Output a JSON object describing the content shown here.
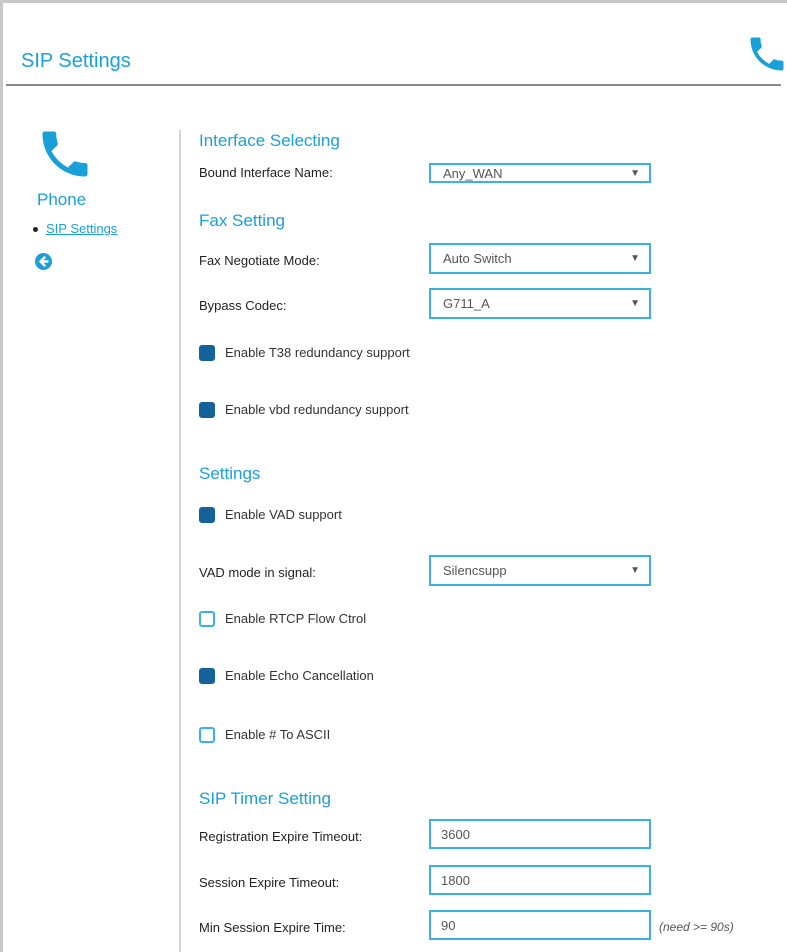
{
  "header": {
    "title": "SIP Settings"
  },
  "sidebar": {
    "title": "Phone",
    "links": [
      {
        "label": "SIP Settings"
      }
    ]
  },
  "interface": {
    "title": "Interface Selecting",
    "bound_label": "Bound Interface Name:",
    "bound_value": "Any_WAN"
  },
  "fax": {
    "title": "Fax Setting",
    "negotiate_label": "Fax Negotiate Mode:",
    "negotiate_value": "Auto Switch",
    "bypass_label": "Bypass Codec:",
    "bypass_value": "G711_A",
    "t38": {
      "label": "Enable T38 redundancy support",
      "checked": true
    },
    "vbd": {
      "label": "Enable vbd redundancy support",
      "checked": true
    }
  },
  "settings": {
    "title": "Settings",
    "vad": {
      "label": "Enable VAD support",
      "checked": true
    },
    "vad_mode_label": "VAD mode in signal:",
    "vad_mode_value": "Silencsupp",
    "rtcp": {
      "label": "Enable RTCP Flow Ctrol",
      "checked": false
    },
    "echo": {
      "label": "Enable Echo Cancellation",
      "checked": true
    },
    "ascii": {
      "label": "Enable # To ASCII",
      "checked": false
    }
  },
  "timer": {
    "title": "SIP Timer Setting",
    "registration_label": "Registration Expire Timeout:",
    "registration_value": "3600",
    "session_label": "Session Expire Timeout:",
    "session_value": "1800",
    "min_session_label": "Min Session Expire Time:",
    "min_session_value": "90",
    "min_session_hint": "(need >= 90s)"
  },
  "colors": {
    "accent": "#1aa0d8",
    "checkbox_checked": "#13639a",
    "input_border": "#3bb2e2"
  }
}
